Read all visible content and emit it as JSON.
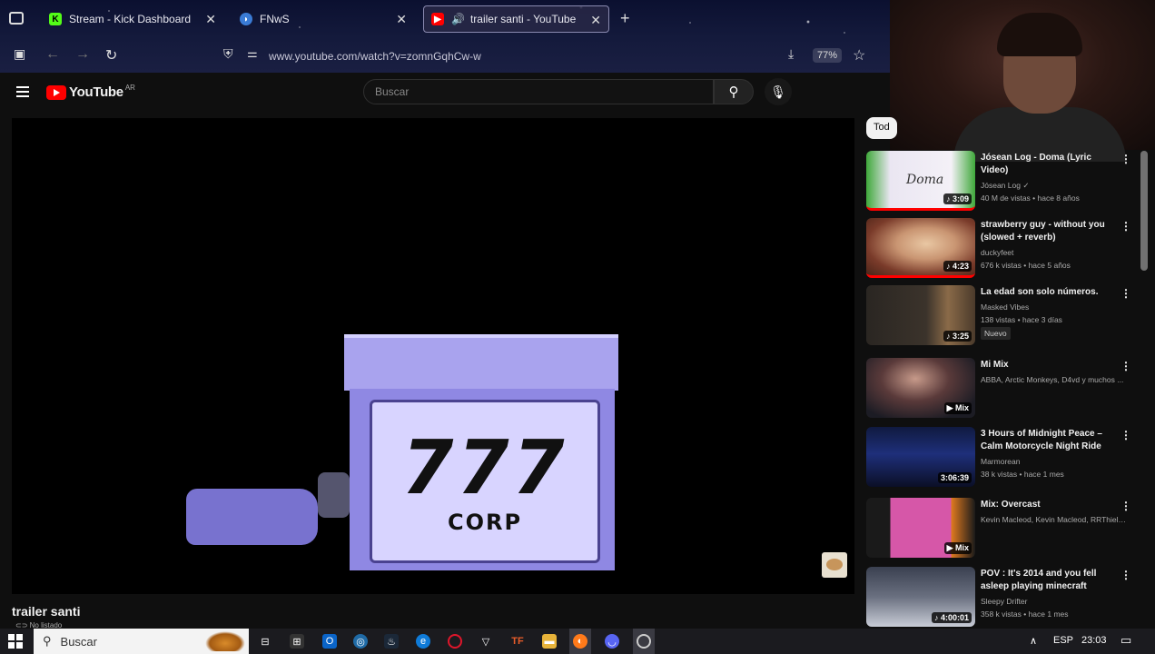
{
  "browser": {
    "tabs": [
      {
        "title": "Stream - Kick Dashboard",
        "favicon": "kick-icon",
        "color": "#53fc18"
      },
      {
        "title": "FNwS",
        "favicon": "fnws-icon",
        "color": "#3a7bd5"
      },
      {
        "title": "trailer santi - YouTube",
        "favicon": "youtube-icon",
        "color": "#ff0000"
      }
    ],
    "url": "www.youtube.com/watch?v=zomnGqhCw-w",
    "zoom": "77%"
  },
  "youtube": {
    "logo_text": "YouTube",
    "country": "AR",
    "search_placeholder": "Buscar"
  },
  "video": {
    "title": "trailer santi",
    "visibility": "No listado",
    "frame_text_big": "777",
    "frame_text_small": "CORP"
  },
  "chips": {
    "first": "Tod"
  },
  "related": [
    {
      "title": "Jósean Log - Doma (Lyric Video)",
      "channel": "Jósean Log",
      "stats": "40 M de vistas • hace 8 años",
      "duration": "3:09",
      "thumb_text": "Doma"
    },
    {
      "title": "strawberry guy - without you (slowed + reverb)",
      "channel": "duckyfeet",
      "stats": "676 k vistas • hace 5 años",
      "duration": "4:23"
    },
    {
      "title": "La edad son solo números.",
      "channel": "Masked Vibes",
      "stats": "138 vistas • hace 3 días",
      "duration": "3:25",
      "badge": "Nuevo"
    },
    {
      "title": "Mi Mix",
      "channel": "ABBA, Arctic Monkeys, D4vd y muchos ...",
      "stats": "",
      "duration": "Mix"
    },
    {
      "title": "3 Hours of Midnight Peace – Calm Motorcycle Night Ride",
      "channel": "Marmorean",
      "stats": "38 k vistas • hace 1 mes",
      "duration": "3:06:39"
    },
    {
      "title": "Mix: Overcast",
      "channel": "Kevin Macleod, Kevin Macleod, RRThiel y...",
      "stats": "",
      "duration": "Mix"
    },
    {
      "title": "POV : It's 2014 and you fell asleep playing minecraft",
      "channel": "Sleepy Drifter",
      "stats": "358 k vistas • hace 1 mes",
      "duration": "4:00:01"
    }
  ],
  "taskbar": {
    "search_label": "Buscar",
    "language": "ESP",
    "time": "23:03"
  }
}
